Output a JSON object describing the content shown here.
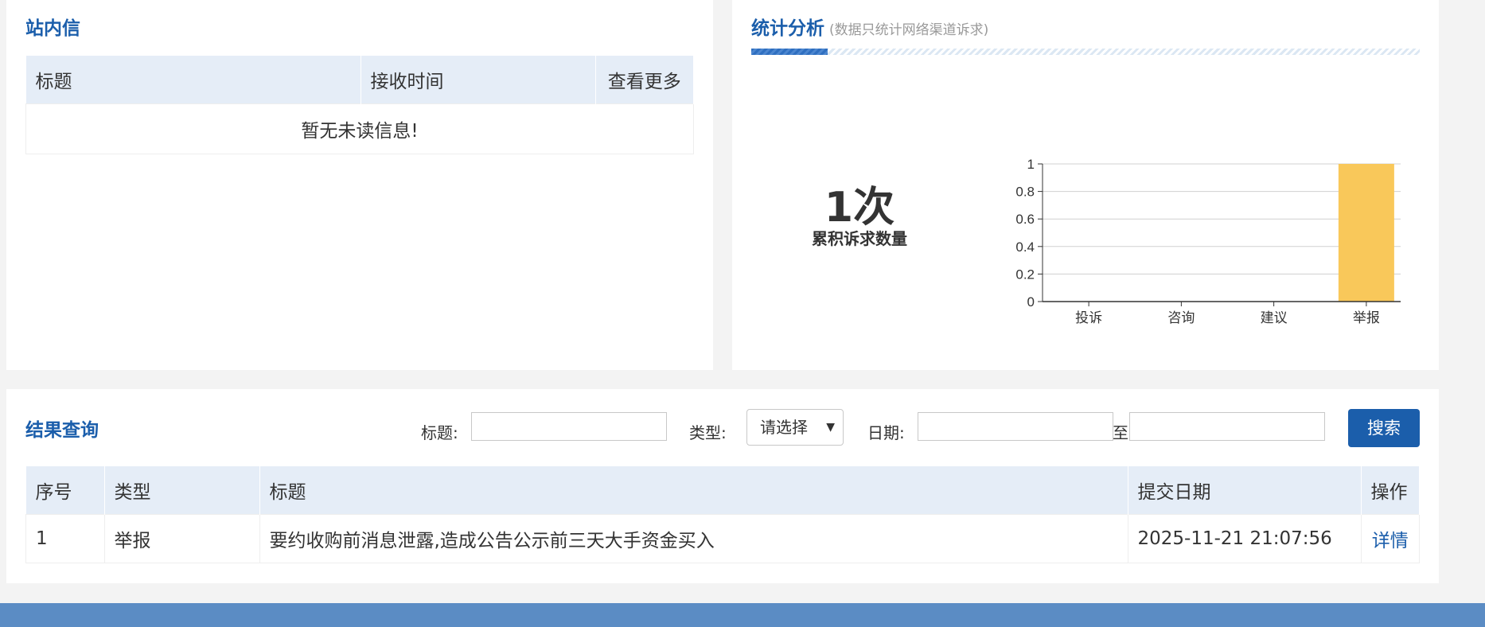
{
  "messages": {
    "title": "站内信",
    "headers": [
      "标题",
      "接收时间",
      "查看更多"
    ],
    "empty_text": "暂无未读信息!"
  },
  "stats": {
    "title": "统计分析",
    "subtitle": "(数据只统计网络渠道诉求)",
    "count_text": "1次",
    "count_label": "累积诉求数量"
  },
  "chart_data": {
    "type": "bar",
    "categories": [
      "投诉",
      "咨询",
      "建议",
      "举报"
    ],
    "values": [
      0,
      0,
      0,
      1
    ],
    "ylim": [
      0,
      1
    ],
    "yticks": [
      "0",
      "0.2",
      "0.4",
      "0.6",
      "0.8",
      "1"
    ],
    "bar_color": "#f9c85a",
    "grid": true
  },
  "query": {
    "title": "结果查询",
    "title_label": "标题:",
    "title_value": "",
    "type_label": "类型:",
    "type_selected": "请选择",
    "date_label": "日期:",
    "date_from": "",
    "date_sep": "至",
    "date_to": "",
    "search_label": "搜索"
  },
  "results": {
    "headers": [
      "序号",
      "类型",
      "标题",
      "提交日期",
      "操作"
    ],
    "rows": [
      {
        "no": "1",
        "type": "举报",
        "title": "要约收购前消息泄露,造成公告公示前三天大手资金买入",
        "date": "2025-11-21 21:07:56",
        "action": "详情"
      }
    ]
  },
  "colors": {
    "accent": "#1b5eab",
    "header_bg": "#e5edf7",
    "footer": "#5b8cc4"
  }
}
